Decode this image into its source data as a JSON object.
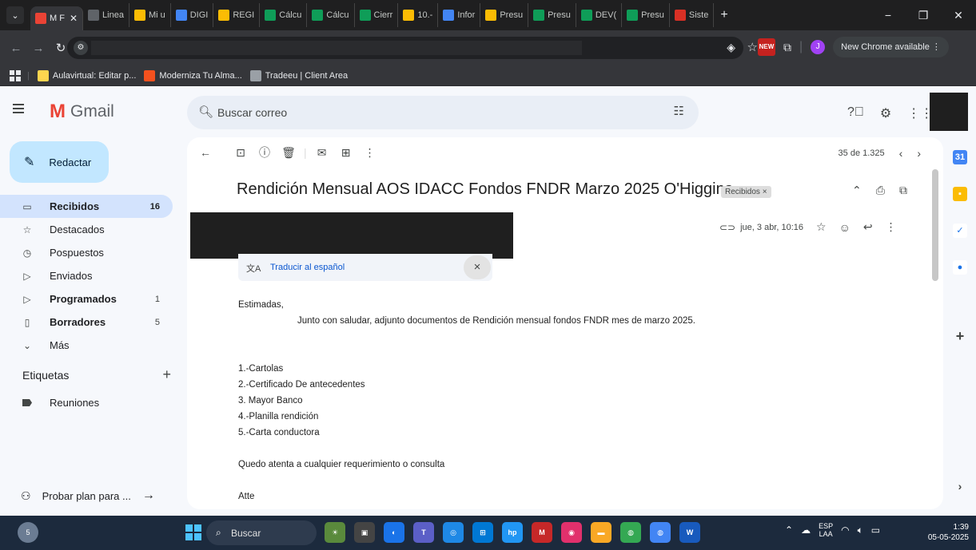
{
  "browser": {
    "tabs": [
      {
        "label": "M F",
        "icon": "gmail-icon",
        "color": "#ea4335",
        "active": true
      },
      {
        "label": "Linea",
        "icon": "chrome-icon",
        "color": "#5f6368"
      },
      {
        "label": "Mi u",
        "icon": "drive-icon",
        "color": "#fbbc04"
      },
      {
        "label": "DIGI",
        "icon": "cloud-icon",
        "color": "#4285f4"
      },
      {
        "label": "REGI",
        "icon": "drive-icon",
        "color": "#fbbc04"
      },
      {
        "label": "Cálcu",
        "icon": "sheets-icon",
        "color": "#0f9d58"
      },
      {
        "label": "Cálcu",
        "icon": "sheets-icon",
        "color": "#0f9d58"
      },
      {
        "label": "Cierr",
        "icon": "sheets-icon",
        "color": "#0f9d58"
      },
      {
        "label": "10.-",
        "icon": "drive-icon",
        "color": "#fbbc04"
      },
      {
        "label": "Infor",
        "icon": "docs-icon",
        "color": "#4285f4"
      },
      {
        "label": "Presu",
        "icon": "drive-icon",
        "color": "#fbbc04"
      },
      {
        "label": "Presu",
        "icon": "sheets-icon",
        "color": "#0f9d58"
      },
      {
        "label": "DEV(",
        "icon": "sheets-icon",
        "color": "#0f9d58"
      },
      {
        "label": "Presu",
        "icon": "sheets-icon",
        "color": "#0f9d58"
      },
      {
        "label": "Siste",
        "icon": "flag-icon",
        "color": "#d93025"
      }
    ],
    "new_chrome": "New Chrome available",
    "new_badge": "NEW",
    "profile_initial": "J",
    "bookmarks": [
      {
        "label": "Aulavirtual: Editar p...",
        "color": "#ffd54f"
      },
      {
        "label": "Moderniza Tu Alma...",
        "color": "#f4511e"
      },
      {
        "label": "Tradeeu | Client Area",
        "color": "#9aa0a6"
      }
    ]
  },
  "gmail": {
    "brand": "Gmail",
    "search_placeholder": "Buscar correo",
    "compose": "Redactar",
    "nav": [
      {
        "label": "Recibidos",
        "count": "16",
        "icon": "inbox-icon",
        "glyph": "▭",
        "active": true,
        "bold": true
      },
      {
        "label": "Destacados",
        "count": "",
        "icon": "star-icon",
        "glyph": "☆"
      },
      {
        "label": "Pospuestos",
        "count": "",
        "icon": "clock-icon",
        "glyph": "◷"
      },
      {
        "label": "Enviados",
        "count": "",
        "icon": "send-icon",
        "glyph": "▷"
      },
      {
        "label": "Programados",
        "count": "1",
        "icon": "scheduled-icon",
        "glyph": "▷",
        "bold": true
      },
      {
        "label": "Borradores",
        "count": "5",
        "icon": "draft-icon",
        "glyph": "▯",
        "bold": true
      },
      {
        "label": "Más",
        "count": "",
        "icon": "chevron-down-icon",
        "glyph": "⌄"
      }
    ],
    "labels_title": "Etiquetas",
    "labels": [
      "Reuniones"
    ],
    "try_plan": "Probar plan para ...",
    "pager": "35 de 1.325",
    "subject": "Rendición Mensual AOS IDACC Fondos FNDR Marzo 2025 O'Higgins",
    "chip": "Recibidos ×",
    "date": "jue, 3 abr, 10:16",
    "translate": "Traducir al español",
    "body": {
      "greeting": "Estimadas,",
      "intro": "Junto con saludar, adjunto documentos de Rendición mensual fondos FNDR mes de marzo 2025.",
      "items": [
        "1.-Cartolas",
        "2.-Certificado De antecedentes",
        "3. Mayor Banco",
        "4.-Planilla rendición",
        "5.-Carta conductora"
      ],
      "closing": "Quedo atenta a cualquier requerimiento o consulta",
      "signoff": "Atte"
    }
  },
  "taskbar": {
    "search": "Buscar",
    "weather_badge": "5",
    "lang_top": "ESP",
    "lang_bottom": "LAA",
    "time": "1:39",
    "date": "05-05-2025"
  }
}
